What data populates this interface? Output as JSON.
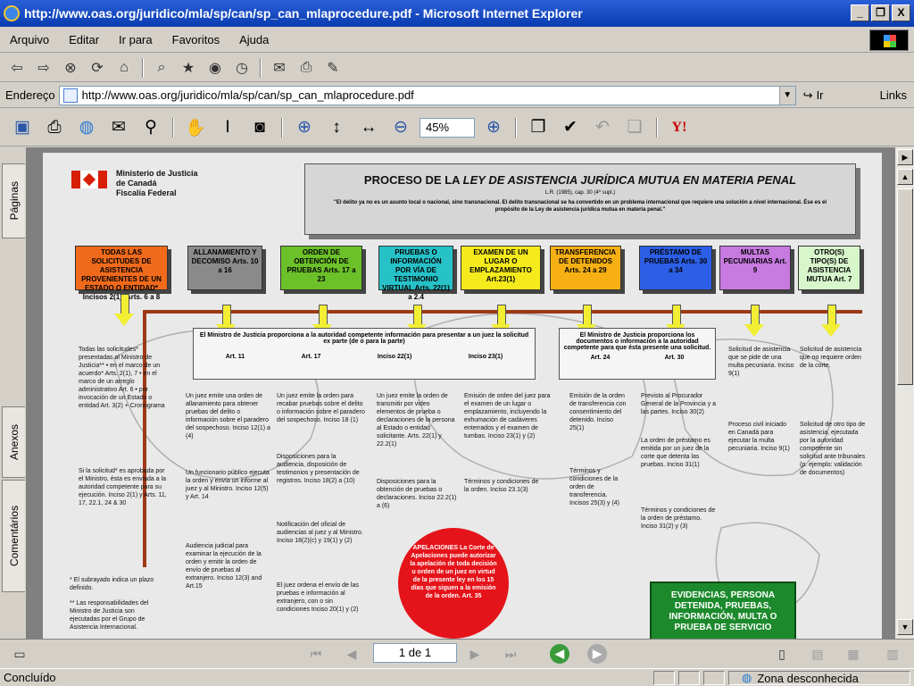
{
  "window": {
    "title": "http://www.oas.org/juridico/mla/sp/can/sp_can_mlaprocedure.pdf - Microsoft Internet Explorer",
    "buttons": [
      "_",
      "❐",
      "X"
    ]
  },
  "menu": [
    "Arquivo",
    "Editar",
    "Ir para",
    "Favoritos",
    "Ajuda"
  ],
  "address": {
    "label": "Endereço",
    "url": "http://www.oas.org/juridico/mla/sp/can/sp_can_mlaprocedure.pdf",
    "go": "Ir",
    "links": "Links"
  },
  "pdf_toolbar": {
    "zoom": "45%"
  },
  "side_tabs": [
    "Páginas",
    "Anexos",
    "Comentários"
  ],
  "document": {
    "org_lines": [
      "Ministerio de Justicia",
      "de Canadá",
      "Fiscalía Federal"
    ],
    "title_prefix": "PROCESO DE LA ",
    "title_italic": "LEY DE ASISTENCIA JURÍDICA MUTUA EN MATERIA PENAL",
    "subtitle": "L.R. (1985), cap. 30 (4º supl.)",
    "quote": "\"El delito ya no es un asunto local o nacional, sino transnacional. El delito transnacional se ha convertido en un problema internacional que requiere una solución a nivel internacional. Ése es el propósito de la Ley de asistencia jurídica mutua en materia penal.\"",
    "boxes": [
      {
        "label": "TODAS LAS SOLICITUDES DE ASISTENCIA PROVENIENTES DE UN ESTADO O ENTIDAD* Incisos 2(1), Arts. 6 a 8",
        "color": "#f06a1c"
      },
      {
        "label": "ALLANAMIENTO Y DECOMISO Arts. 10 a 16",
        "color": "#8a8a8a"
      },
      {
        "label": "ORDEN DE OBTENCIÓN DE PRUEBAS Arts. 17 a 23",
        "color": "#6cc02a"
      },
      {
        "label": "PRUEBAS O INFORMACIÓN POR VÍA DE TESTIMONIO VIRTUAL Arts. 22(1) a 2.4",
        "color": "#27c2c8"
      },
      {
        "label": "EXAMEN DE UN LUGAR O EMPLAZAMIENTO Art.23(1)",
        "color": "#f4ea1c"
      },
      {
        "label": "TRANSFERENCIA DE DETENIDOS Arts. 24 a 29",
        "color": "#f6b014"
      },
      {
        "label": "PRÉSTAMO DE PRUEBAS Arts. 30 a 34",
        "color": "#2c5fe6"
      },
      {
        "label": "MULTAS PECUNIARIAS Art. 9",
        "color": "#c77ae0"
      },
      {
        "label": "OTRO(S) TIPO(S) DE ASISTENCIA MUTUA Art. 7",
        "color": "#d8f6cc"
      }
    ],
    "info_left": "El Ministro de Justicia proporciona a la autoridad competente información para presentar a un juez la solicitud ex parte (de o para la parte)",
    "info_left_arts": [
      "Art. 11",
      "Art. 17",
      "Inciso 22(1)",
      "Inciso 23(1)"
    ],
    "info_right": "El Ministro de Justicia proporciona los documentos o información a la autoridad competente para que ésta presente una solicitud.",
    "info_right_arts": [
      "Art. 24",
      "Art. 30"
    ],
    "col_texts": [
      "Todas las solicitudes* presentadas al Ministro de Justicia** • en el marco de un acuerdo* Arts. 2(1), 7 • en el marco de un arreglo administrativo Art. 6 • por invocación de un Estado o entidad Art. 3(2) + Cronograma",
      "Un juez emite una orden de allanamiento para obtener pruebas del delito o información sobre el paradero del sospechoso. Inciso 12(1) a (4)",
      "Un juez emite la orden para recabar pruebas sobre el delito o información sobre el paradero del sospechoso. Inciso 18 (1)",
      "Un juez emite la orden de transmitir por video elementos de prueba o declaraciones de la persona al Estado o entidad solicitante. Arts. 22(1) y 22.2(1)",
      "Emisión de orden del juez para el examen de un lugar o emplazamiento, incluyendo la exhumación de cadáveres enterrados y el examen de tumbas. Inciso 23(1) y (2)",
      "Emisión de la orden de transferencia con consentimiento del detenido. Inciso 25(1)",
      "Previsto al Procurador General de la Provincia y a las partes. Inciso 30(2)",
      "Solicitud de asistencia que se pide de una multa pecuniaria. Inciso 9(1)",
      "Solicitud de asistencia que no requiere orden de la corte."
    ],
    "lower_texts": [
      "Si la solicitud* es aprobada por el Ministro, ésta es enviada a la autoridad competente para su ejecución. Inciso 2(1) y Arts. 11, 17, 22.1, 24 & 30",
      "Un funcionario público ejecuta la orden y envía un informe al juez y al Ministro. Inciso 12(5) y Art. 14",
      "Disposiciones para la audiencia, disposición de testimonios y presentación de registros. Inciso 18(2) a (10)",
      "Disposiciones para la obtención de pruebas o declaraciones. Inciso 22.2(1) a (6)",
      "Términos y condiciones de la orden. Inciso 23.1(3)",
      "Términos y condiciones de la orden de transferencia. Incisos 25(3) y (4)",
      "La orden de préstamo es emitida por un juez de la corte que detenta las pruebas. Inciso 31(1)",
      "Proceso civil iniciado en Canadá para ejecutar la multa pecuniaria. Inciso 9(1)",
      "Solicitud de otro tipo de asistencia, ejecutada por la autoridad competente sin solicitud ante tribunales (p. ejemplo: validación de documentos)"
    ],
    "bottom_texts": [
      "Audiencia judicial para examinar la ejecución de la orden y emitir la orden de envío de pruebas al extranjero. Inciso 12(3) and Art.15",
      "Notificación del oficial de audiencias al juez y al Ministro. Inciso 18(2)(c) y 19(1) y (2)",
      "El juez ordena el envío de las pruebas e información al extranjero, con o sin condiciones Inciso 20(1) y (2)",
      "Términos y condiciones de la orden de préstamo. Inciso 31(2) y (3)"
    ],
    "footnotes": [
      "* El subrayado indica un plazo definido.",
      "** Las responsabilidades del Ministro de Justicia son ejecutadas por el Grupo de Asistencia Internacional."
    ],
    "appeals": "APELACIONES La Corte de Apelaciones puede autorizar la apelación de toda decisión u orden de un juez en virtud de la presente ley en los 15 días que siguen a la emisión de la orden. Art. 35",
    "green": "EVIDENCIAS, PERSONA DETENIDA, PRUEBAS, INFORMACIÓN, MULTA O PRUEBA DE SERVICIO"
  },
  "nav": {
    "page_indicator": "1 de 1"
  },
  "status": {
    "left": "Concluído",
    "zone": "Zona desconhecida"
  }
}
